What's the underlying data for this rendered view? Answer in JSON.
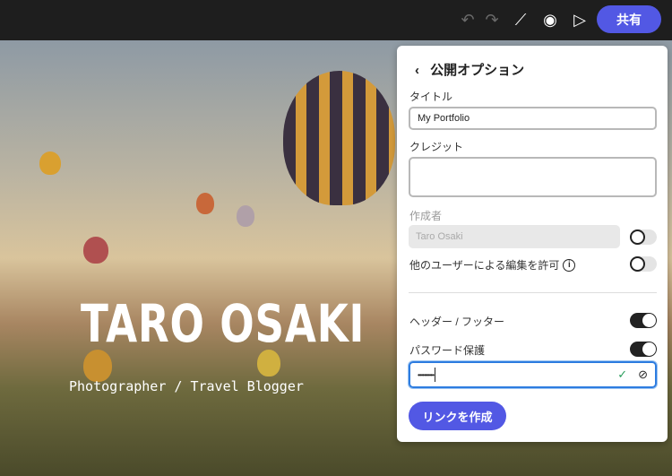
{
  "topbar": {
    "undo_icon": "undo-icon",
    "redo_icon": "redo-icon",
    "magic_icon": "magic-wand-icon",
    "preview_icon": "eye-icon",
    "play_icon": "play-icon",
    "share_label": "共有",
    "accent": "#5258e4"
  },
  "hero": {
    "title": "TARO OSAKI",
    "subtitle": "Photographer / Travel Blogger"
  },
  "panel": {
    "title": "公開オプション",
    "title_label": "タイトル",
    "title_value": "My Portfolio",
    "credit_label": "クレジット",
    "credit_value": "",
    "author_label": "作成者",
    "author_value": "Taro Osaki",
    "author_toggle": false,
    "allow_edit_label": "他のユーザーによる編集を許可",
    "allow_edit_toggle": false,
    "header_footer_label": "ヘッダー / フッター",
    "header_footer_toggle": true,
    "password_label": "パスワード保護",
    "password_toggle": true,
    "password_value": "••••••••••",
    "create_link_label": "リンクを作成"
  }
}
